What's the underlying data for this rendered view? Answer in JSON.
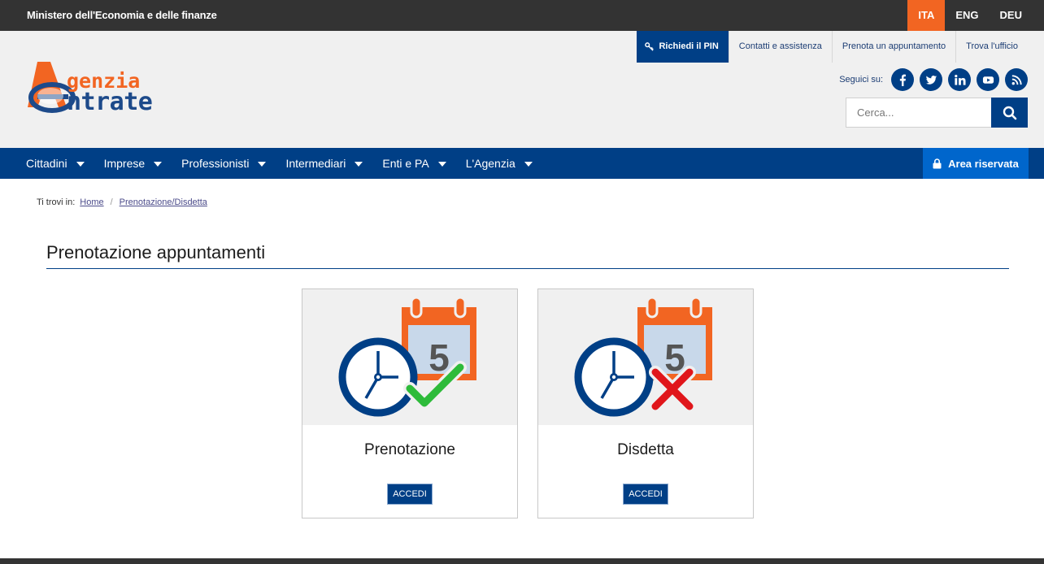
{
  "topbar": {
    "ministry": "Ministero dell'Economia e delle finanze",
    "languages": [
      {
        "label": "ITA",
        "active": true
      },
      {
        "label": "ENG",
        "active": false
      },
      {
        "label": "DEU",
        "active": false
      }
    ]
  },
  "header": {
    "logo": {
      "line1": "genzia",
      "line2": "ntrate"
    },
    "utility": {
      "pin": "Richiedi il PIN",
      "contacts": "Contatti e assistenza",
      "booking": "Prenota un appuntamento",
      "office": "Trova l'ufficio"
    },
    "social": {
      "label": "Seguici su:",
      "icons": [
        "facebook-icon",
        "twitter-icon",
        "linkedin-icon",
        "youtube-icon",
        "rss-icon"
      ]
    },
    "search": {
      "placeholder": "Cerca..."
    }
  },
  "nav": {
    "items": [
      "Cittadini",
      "Imprese",
      "Professionisti",
      "Intermediari",
      "Enti e PA",
      "L'Agenzia"
    ],
    "area": "Area riservata"
  },
  "breadcrumb": {
    "prefix": "Ti trovi in:",
    "home": "Home",
    "current": "Prenotazione/Disdetta"
  },
  "page": {
    "title": "Prenotazione appuntamenti"
  },
  "cards": [
    {
      "title": "Prenotazione",
      "button": "ACCEDI",
      "icon": "calendar-clock-check-icon",
      "calendar_day": "5"
    },
    {
      "title": "Disdetta",
      "button": "ACCEDI",
      "icon": "calendar-clock-cross-icon",
      "calendar_day": "5"
    }
  ],
  "colors": {
    "brand_blue": "#003f86",
    "accent_orange": "#f26522",
    "area_blue": "#0066cc",
    "check_green": "#2dbb3a",
    "cross_red": "#e0161b"
  }
}
